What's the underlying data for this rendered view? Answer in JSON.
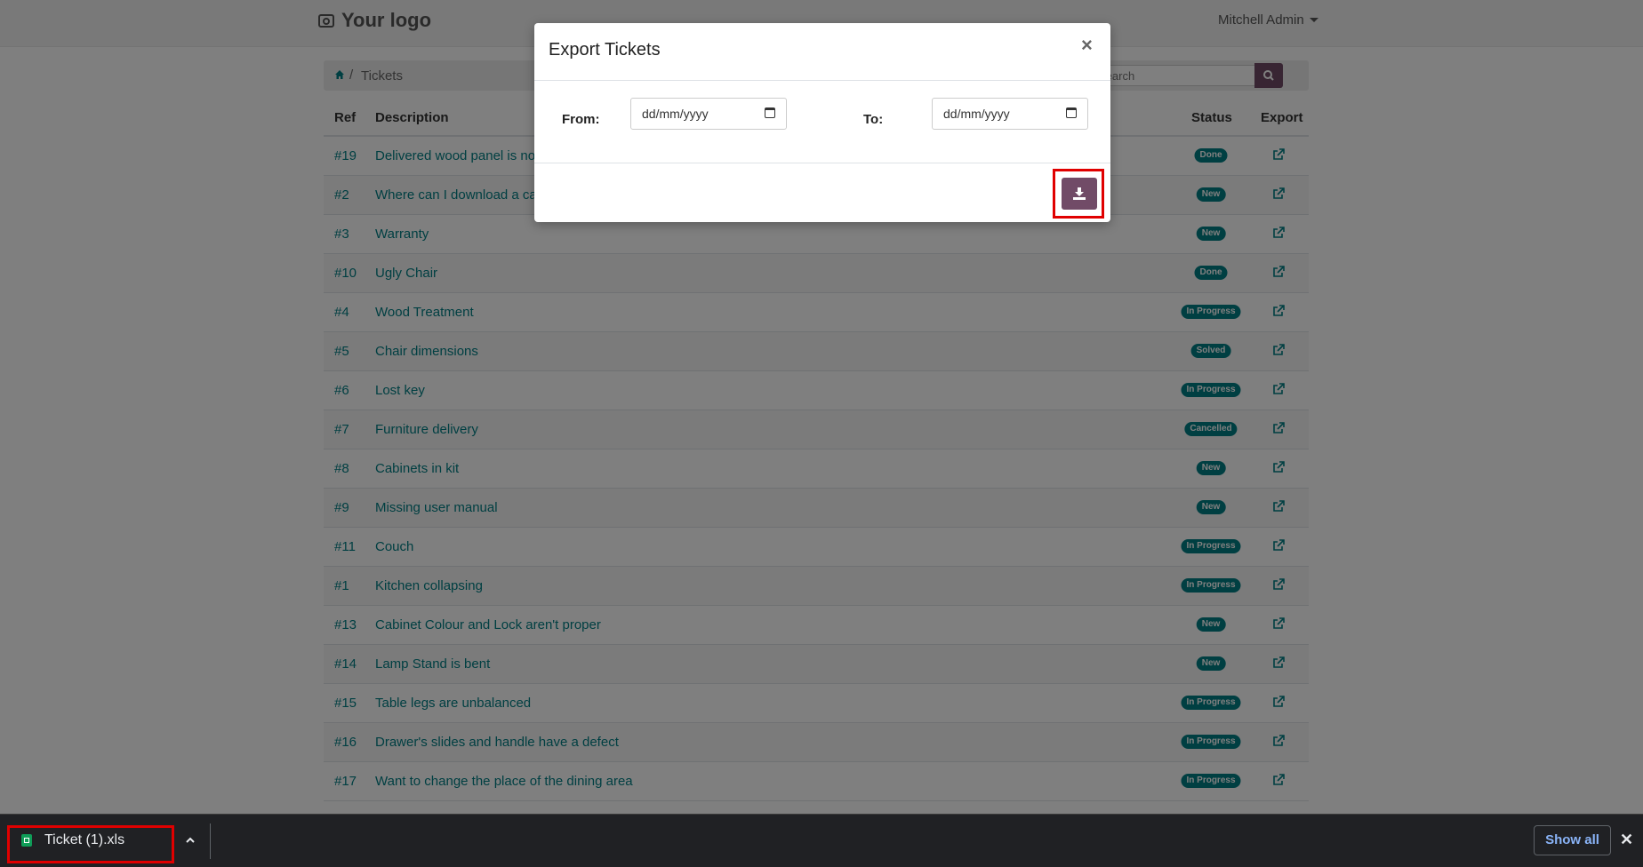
{
  "header": {
    "logo": "Your logo",
    "user": "Mitchell Admin"
  },
  "breadcrumb": {
    "separator": "/",
    "current": "Tickets"
  },
  "search": {
    "placeholder": "Search"
  },
  "table": {
    "columns": [
      "Ref",
      "Description",
      "Status",
      "Export"
    ],
    "rows": [
      {
        "ref": "#19",
        "description": "Delivered wood panel is not w",
        "status": "Done"
      },
      {
        "ref": "#2",
        "description": "Where can I download a cata",
        "status": "New"
      },
      {
        "ref": "#3",
        "description": "Warranty",
        "status": "New"
      },
      {
        "ref": "#10",
        "description": "Ugly Chair",
        "status": "Done"
      },
      {
        "ref": "#4",
        "description": "Wood Treatment",
        "status": "In Progress"
      },
      {
        "ref": "#5",
        "description": "Chair dimensions",
        "status": "Solved"
      },
      {
        "ref": "#6",
        "description": "Lost key",
        "status": "In Progress"
      },
      {
        "ref": "#7",
        "description": "Furniture delivery",
        "status": "Cancelled"
      },
      {
        "ref": "#8",
        "description": "Cabinets in kit",
        "status": "New"
      },
      {
        "ref": "#9",
        "description": "Missing user manual",
        "status": "New"
      },
      {
        "ref": "#11",
        "description": "Couch",
        "status": "In Progress"
      },
      {
        "ref": "#1",
        "description": "Kitchen collapsing",
        "status": "In Progress"
      },
      {
        "ref": "#13",
        "description": "Cabinet Colour and Lock aren't proper",
        "status": "New"
      },
      {
        "ref": "#14",
        "description": "Lamp Stand is bent",
        "status": "New"
      },
      {
        "ref": "#15",
        "description": "Table legs are unbalanced",
        "status": "In Progress"
      },
      {
        "ref": "#16",
        "description": "Drawer's slides and handle have a defect",
        "status": "In Progress"
      },
      {
        "ref": "#17",
        "description": "Want to change the place of the dining area",
        "status": "In Progress"
      }
    ]
  },
  "modal": {
    "title": "Export Tickets",
    "close": "×",
    "from_label": "From:",
    "to_label": "To:",
    "from_value": "dd/mm/yyyy",
    "to_value": "dd/mm/yyyy"
  },
  "downloads": {
    "file_name": "Ticket (1).xls",
    "show_all": "Show all",
    "close": "✕"
  },
  "colors": {
    "primary": "#714b67",
    "link": "#017e84",
    "highlight": "#e00000"
  }
}
